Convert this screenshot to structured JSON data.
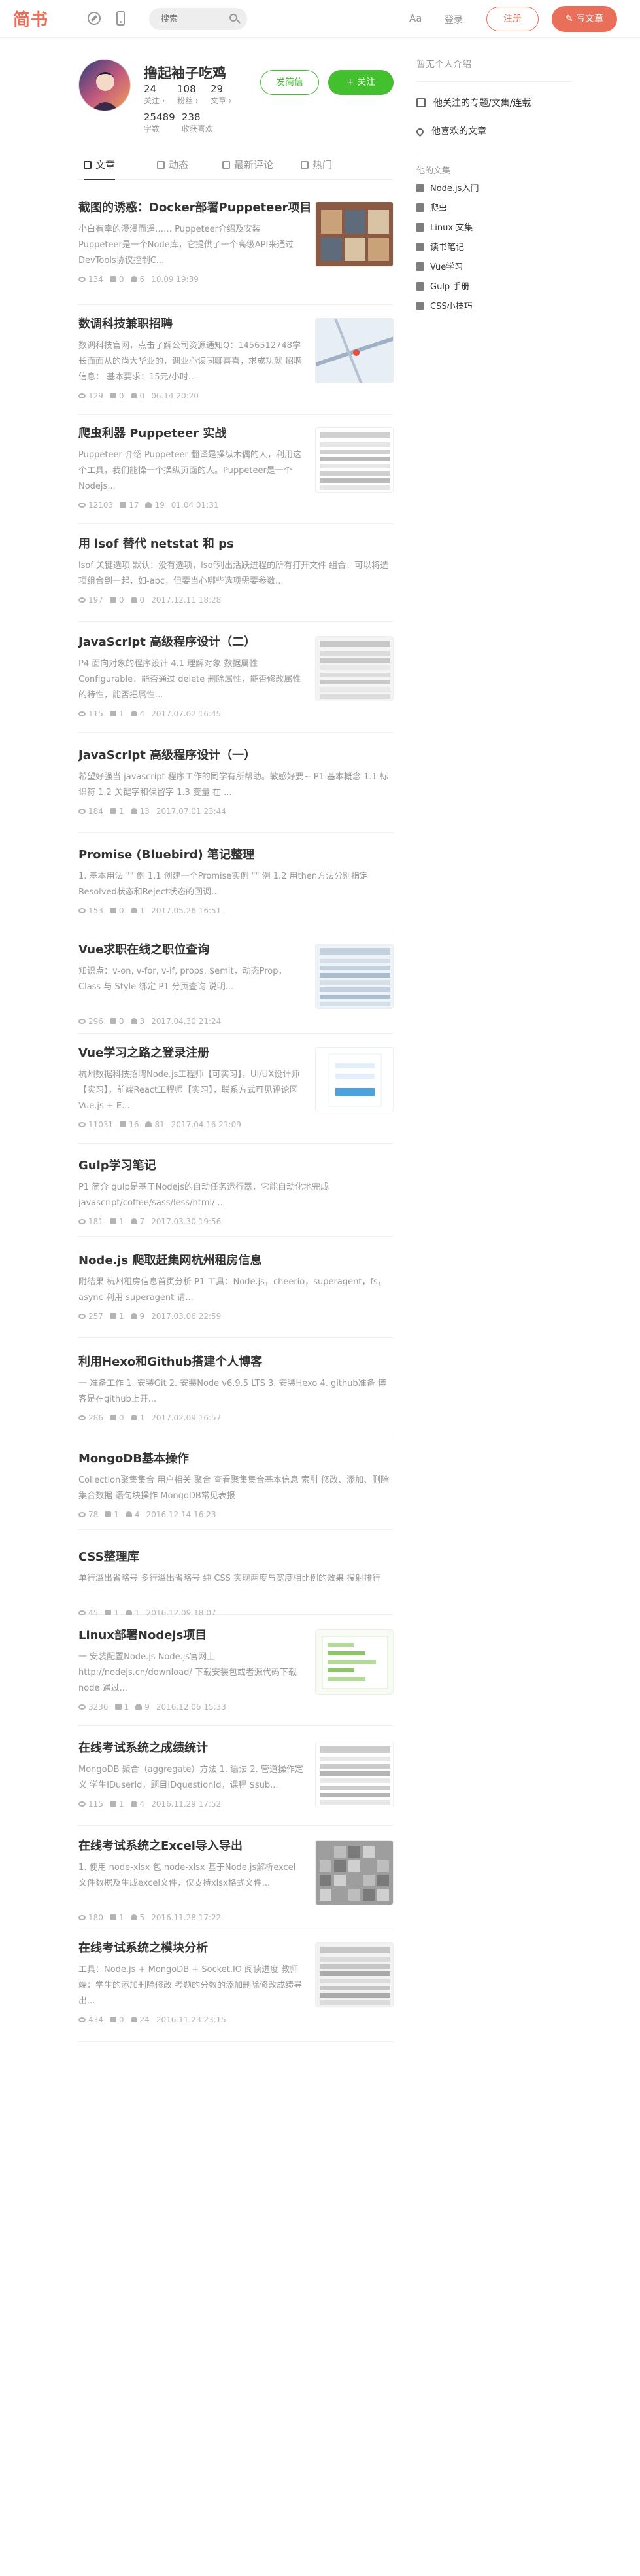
{
  "header": {
    "logo": "简书",
    "search_placeholder": "搜索",
    "font_toggle": "Aa",
    "login": "登录",
    "signup": "注册",
    "write": "✎ 写文章",
    "brand_color": "#ea6f5a"
  },
  "profile": {
    "name": "撸起袖子吃鸡",
    "stats": [
      {
        "num": "24",
        "label": "关注 ›"
      },
      {
        "num": "108",
        "label": "粉丝 ›"
      },
      {
        "num": "29",
        "label": "文章 ›"
      },
      {
        "num": "25489",
        "label": "字数"
      },
      {
        "num": "238",
        "label": "收获喜欢"
      }
    ],
    "follow_all": "发简信",
    "follow": "+ 关注"
  },
  "tabs": [
    {
      "label": "文章"
    },
    {
      "label": "动态"
    },
    {
      "label": "最新评论"
    },
    {
      "label": "热门"
    }
  ],
  "articles": [
    {
      "title": "截图的诱惑：Docker部署Puppeteer项目",
      "abstract": "小白有幸的漫漫而遥…… Puppeteer介绍及安装 Puppeteer是一个Node库，它提供了一个高级API来通过DevTools协议控制C...",
      "views": "134",
      "comments": "0",
      "likes": "6",
      "time": "10.09 19:39"
    },
    {
      "title": "数调科技兼职招聘",
      "abstract": "数调科技官网，点击了解公司资源通知Q：1456512748学长面面从的尚大华业的，调业心读同聊喜喜，求成功就 招聘信息： 基本要求：15元/小时...",
      "views": "129",
      "comments": "0",
      "likes": "0",
      "time": "06.14 20:20"
    },
    {
      "title": "爬虫利器 Puppeteer 实战",
      "abstract": "Puppeteer 介绍 Puppeteer 翻译是操纵木偶的人，利用这个工具，我们能操一个操纵页面的人。Puppeteer是一个Nodejs...",
      "views": "12103",
      "comments": "17",
      "likes": "19",
      "time": "01.04 01:31"
    },
    {
      "title": "用 lsof 替代 netstat 和 ps",
      "abstract": "lsof 关键选项 默认：没有选项，lsof列出活跃进程的所有打开文件 组合：可以将选项组合到一起，如-abc，但要当心哪些选项需要参数...",
      "views": "197",
      "comments": "0",
      "likes": "0",
      "time": "2017.12.11 18:28"
    },
    {
      "title": "JavaScript 高级程序设计（二）",
      "abstract": "P4 面向对象的程序设计 4.1 理解对象 数据属性 Configurable：能否通过 delete 删除属性，能否修改属性的特性，能否把属性...",
      "views": "115",
      "comments": "1",
      "likes": "4",
      "time": "2017.07.02 16:45"
    },
    {
      "title": "JavaScript 高级程序设计（一）",
      "abstract": "希望好强当 javascript 程序工作的同学有所帮助。敏感好要~ P1 基本概念 1.1 标识符 1.2 关键字和保留字 1.3 变量 在 ...",
      "views": "184",
      "comments": "1",
      "likes": "13",
      "time": "2017.07.01 23:44"
    },
    {
      "title": "Promise (Bluebird) 笔记整理",
      "abstract": "1. 基本用法 \"\" 例 1.1 创建一个Promise实例 \"\" 例 1.2 用then方法分别指定Resolved状态和Reject状态的回调...",
      "views": "153",
      "comments": "0",
      "likes": "1",
      "time": "2017.05.26 16:51"
    },
    {
      "title": "Vue求职在线之职位查询",
      "abstract": "知识点：v-on, v-for, v-if, props, $emit，动态Prop，Class 与 Style 绑定 P1 分页查询 说明...",
      "views": "296",
      "comments": "0",
      "likes": "3",
      "time": "2017.04.30 21:24"
    },
    {
      "title": "Vue学习之路之登录注册",
      "abstract": "杭州数据科技招聘Node.js工程师【可实习】，UI/UX设计师【实习】，前端React工程师【实习】，联系方式可见评论区 Vue.js + E...",
      "views": "11031",
      "comments": "16",
      "likes": "81",
      "time": "2017.04.16 21:09"
    },
    {
      "title": "Gulp学习笔记",
      "abstract": "P1 简介 gulp是基于Nodejs的自动任务运行器，它能自动化地完成 javascript/coffee/sass/less/html/...",
      "views": "181",
      "comments": "1",
      "likes": "7",
      "time": "2017.03.30 19:56"
    },
    {
      "title": "Node.js 爬取赶集网杭州租房信息",
      "abstract": "附结果 杭州租房信息首页分析 P1 工具：Node.js，cheerio，superagent，fs，async 利用 superagent 请...",
      "views": "257",
      "comments": "1",
      "likes": "9",
      "time": "2017.03.06 22:59"
    },
    {
      "title": "利用Hexo和Github搭建个人博客",
      "abstract": "一 准备工作 1. 安装Git 2. 安装Node v6.9.5 LTS 3. 安装Hexo 4. github准备 博客是在github上开...",
      "views": "286",
      "comments": "0",
      "likes": "1",
      "time": "2017.02.09 16:57"
    },
    {
      "title": "MongoDB基本操作",
      "abstract": "Collection聚集集合 用户相关 聚合 查看聚集集合基本信息 索引 修改、添加、删除集合数据 语句块操作 MongoDB常见表报",
      "views": "78",
      "comments": "1",
      "likes": "4",
      "time": "2016.12.14 16:23"
    },
    {
      "title": "CSS整理库",
      "abstract": "单行溢出省略号 多行溢出省略号 纯 CSS 实现两度与宽度相比例的效果 搜射排行",
      "views": "45",
      "comments": "1",
      "likes": "1",
      "time": "2016.12.09 18:07"
    },
    {
      "title": "Linux部署Nodejs项目",
      "abstract": "一 安装配置Node.js Node.js官网上http://nodejs.cn/download/ 下载安装包或者源代码下载node 通过...",
      "views": "3236",
      "comments": "1",
      "likes": "9",
      "time": "2016.12.06 15:33"
    },
    {
      "title": "在线考试系统之成绩统计",
      "abstract": "MongoDB 聚合（aggregate）方法 1. 语法 2. 管道操作定义 学生IDuserId，题目IDquestionId，课程 $sub...",
      "views": "115",
      "comments": "1",
      "likes": "4",
      "time": "2016.11.29 17:52"
    },
    {
      "title": "在线考试系统之Excel导入导出",
      "abstract": "1. 使用 node-xlsx 包 node-xlsx 基于Node.js解析excel文件数据及生成excel文件，仅支持xlsx格式文件...",
      "views": "180",
      "comments": "1",
      "likes": "5",
      "time": "2016.11.28 17:22"
    },
    {
      "title": "在线考试系统之模块分析",
      "abstract": "工具：Node.js + MongoDB + Socket.IO 阅读进度 教师端：学生的添加删除修改 考题的分数的添加删除修改成绩导出...",
      "views": "434",
      "comments": "0",
      "likes": "24",
      "time": "2016.11.23 23:15"
    }
  ],
  "sidebar": {
    "intro_title": "暂无个人介绍",
    "links": [
      {
        "label": "他关注的专题/文集/连载"
      },
      {
        "label": "他喜欢的文章"
      }
    ],
    "notebooks_title": "他的文集",
    "notebooks": [
      {
        "label": "Node.js入门"
      },
      {
        "label": "爬虫"
      },
      {
        "label": "Linux 文集"
      },
      {
        "label": "读书笔记"
      },
      {
        "label": "Vue学习"
      },
      {
        "label": "Gulp 手册"
      },
      {
        "label": "CSS小技巧"
      }
    ]
  }
}
